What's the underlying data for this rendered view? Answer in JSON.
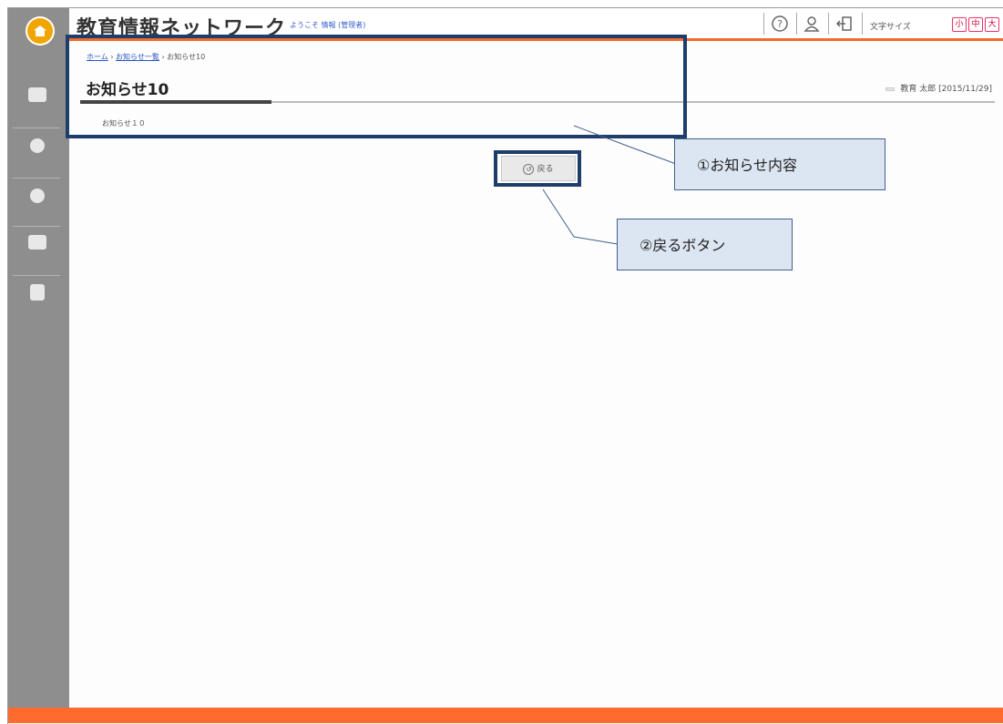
{
  "header": {
    "app_title": "教育情報ネットワーク",
    "welcome_text": "ようこそ 情報 (管理者)",
    "icons": [
      "help-icon",
      "user-icon",
      "logout-icon"
    ],
    "font_size_label": "文字サイズ",
    "font_size_buttons": [
      "小",
      "中",
      "大"
    ]
  },
  "sidebar": {
    "items": [
      {
        "icon": "mail-icon"
      },
      {
        "icon": "globe-icon"
      },
      {
        "icon": "chat-icon"
      },
      {
        "icon": "folder-icon"
      },
      {
        "icon": "book-icon"
      }
    ]
  },
  "breadcrumb": {
    "home": "ホーム",
    "list": "お知らせ一覧",
    "current": "お知らせ10"
  },
  "notice": {
    "title": "お知らせ10",
    "meta": "教育 太郎 [2015/11/29]",
    "body": "お知らせ１０"
  },
  "back_button": {
    "label": "戻る"
  },
  "annotations": {
    "callout1": "①お知らせ内容",
    "callout2": "②戻るボタン"
  },
  "colors": {
    "accent_orange": "#f26a2e",
    "sidebar_gray": "#8e8e8e",
    "highlight_navy": "#1f3d6b",
    "callout_fill": "#dce6f2"
  }
}
